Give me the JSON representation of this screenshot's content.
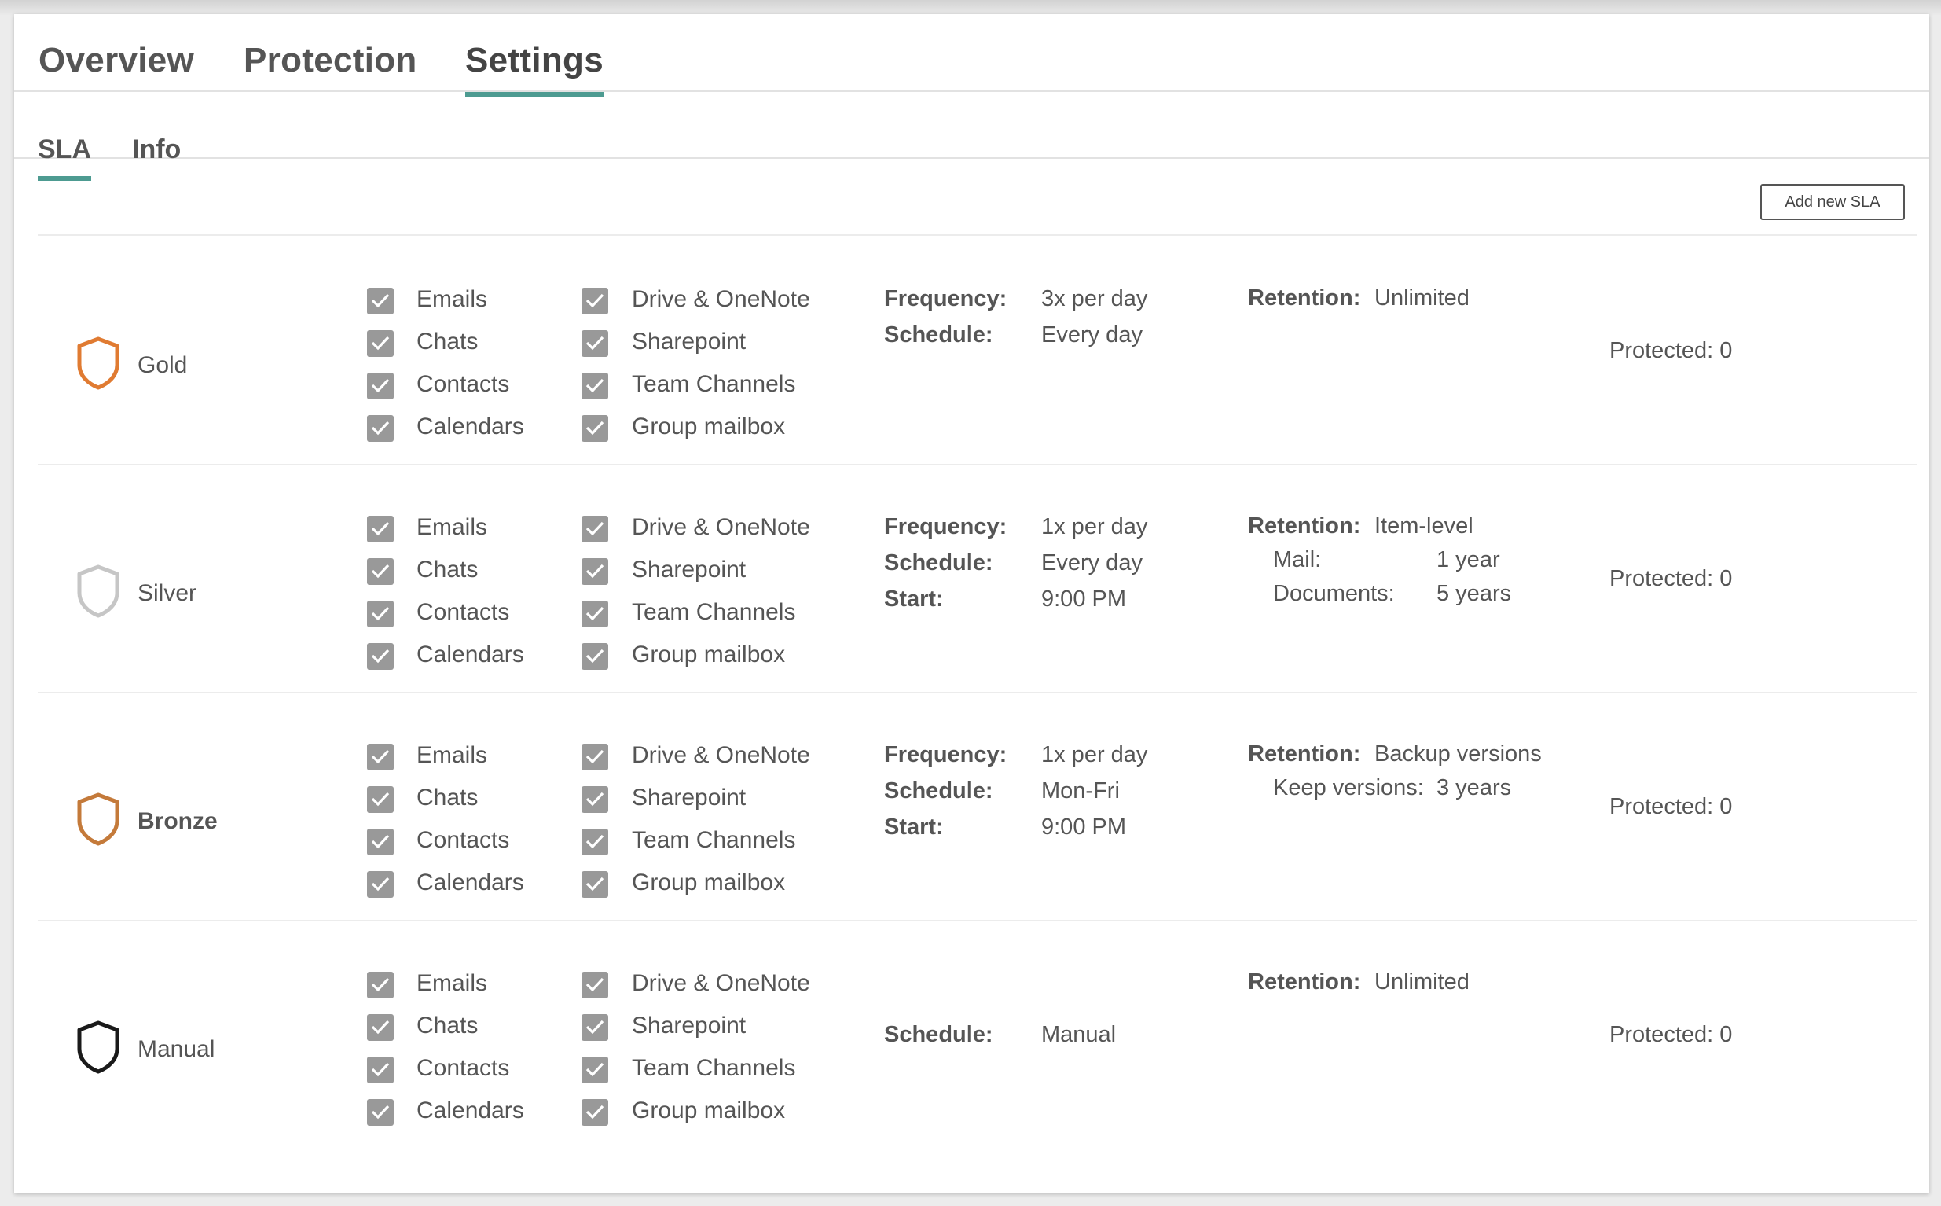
{
  "tabs": {
    "overview": "Overview",
    "protection": "Protection",
    "settings": "Settings"
  },
  "subtabs": {
    "sla": "SLA",
    "info": "Info"
  },
  "add_sla_label": "Add new SLA",
  "colors": {
    "accent": "#4d9b91",
    "gold": "#e07b32",
    "silver": "#c6c6c6",
    "bronze": "#c47a3a",
    "manual": "#1a1a1a",
    "checkbox": "#999999"
  },
  "slas": [
    {
      "name": "Gold",
      "icon": "gold-shield-icon",
      "items_left": [
        "Emails",
        "Chats",
        "Contacts",
        "Calendars"
      ],
      "items_right": [
        "Drive & OneNote",
        "Sharepoint",
        "Team Channels",
        "Group mailbox"
      ],
      "frequency_label": "Frequency:",
      "frequency": "3x per day",
      "schedule_label": "Schedule:",
      "schedule": "Every day",
      "retention_label": "Retention:",
      "retention": "Unlimited",
      "protected": "Protected: 0"
    },
    {
      "name": "Silver",
      "icon": "silver-shield-icon",
      "items_left": [
        "Emails",
        "Chats",
        "Contacts",
        "Calendars"
      ],
      "items_right": [
        "Drive & OneNote",
        "Sharepoint",
        "Team Channels",
        "Group mailbox"
      ],
      "frequency_label": "Frequency:",
      "frequency": "1x per day",
      "schedule_label": "Schedule:",
      "schedule": "Every day",
      "start_label": "Start:",
      "start": "9:00 PM",
      "retention_label": "Retention:",
      "retention": "Item-level",
      "retention_details": [
        {
          "label": "Mail:",
          "value": "1 year"
        },
        {
          "label": "Documents:",
          "value": "5 years"
        }
      ],
      "protected": "Protected: 0"
    },
    {
      "name": "Bronze",
      "icon": "bronze-shield-icon",
      "items_left": [
        "Emails",
        "Chats",
        "Contacts",
        "Calendars"
      ],
      "items_right": [
        "Drive & OneNote",
        "Sharepoint",
        "Team Channels",
        "Group mailbox"
      ],
      "frequency_label": "Frequency:",
      "frequency": "1x per day",
      "schedule_label": "Schedule:",
      "schedule": "Mon-Fri",
      "start_label": "Start:",
      "start": "9:00 PM",
      "retention_label": "Retention:",
      "retention": "Backup versions",
      "retention_details": [
        {
          "label": "Keep versions:",
          "value": "3 years"
        }
      ],
      "protected": "Protected: 0"
    },
    {
      "name": "Manual",
      "icon": "manual-shield-icon",
      "items_left": [
        "Emails",
        "Chats",
        "Contacts",
        "Calendars"
      ],
      "items_right": [
        "Drive & OneNote",
        "Sharepoint",
        "Team Channels",
        "Group mailbox"
      ],
      "schedule_label": "Schedule:",
      "schedule": "Manual",
      "retention_label": "Retention:",
      "retention": "Unlimited",
      "protected": "Protected: 0"
    }
  ]
}
